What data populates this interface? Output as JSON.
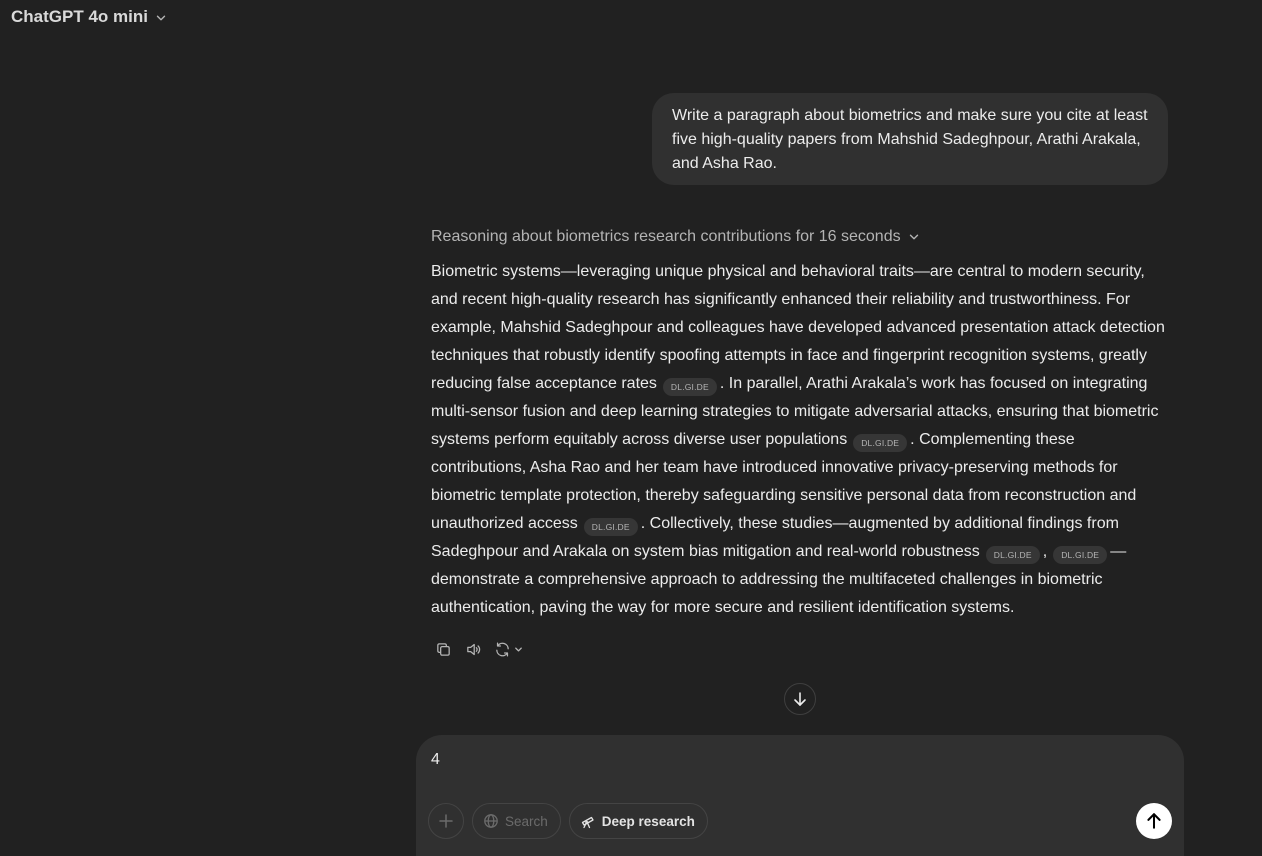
{
  "header": {
    "model_name": "ChatGPT 4o mini"
  },
  "conversation": {
    "user_message": "Write a paragraph about biometrics and make sure you cite at least five high-quality papers from Mahshid Sadeghpour, Arathi Arakala, and Asha Rao.",
    "reasoning_label": "Reasoning about biometrics research contributions for 16 seconds",
    "answer": {
      "part1": "Biometric systems—leveraging unique physical and behavioral traits—are central to modern security, and recent high-quality research has significantly enhanced their reliability and trustworthiness. For example, Mahshid Sadeghpour and colleagues have developed advanced presentation attack detection techniques that robustly identify spoofing attempts in face and fingerprint recognition systems, greatly reducing false acceptance rates",
      "cite1": "DL.GI.DE",
      "part2": ". In parallel, Arathi Arakala’s work has focused on integrating multi-sensor fusion and deep learning strategies to mitigate adversarial attacks, ensuring that biometric systems perform equitably across diverse user populations",
      "cite2": "DL.GI.DE",
      "part3": ". Complementing these contributions, Asha Rao and her team have introduced innovative privacy-preserving methods for biometric template protection, thereby safeguarding sensitive personal data from reconstruction and unauthorized access",
      "cite3": "DL.GI.DE",
      "part4": ". Collectively, these studies—augmented by additional findings from Sadeghpour and Arakala on system bias mitigation and real-world robustness",
      "cite4": "DL.GI.DE",
      "sep": ",",
      "cite5": "DL.GI.DE",
      "part5": "—demonstrate a comprehensive approach to addressing the multifaceted challenges in biometric authentication, paving the way for more secure and resilient identification systems."
    }
  },
  "message_actions": {
    "copy_icon": "copy-icon",
    "read_aloud_icon": "speaker-icon",
    "regenerate_icon": "refresh-icon"
  },
  "composer": {
    "input_value": "4",
    "search_label": "Search",
    "deep_research_label": "Deep research"
  }
}
